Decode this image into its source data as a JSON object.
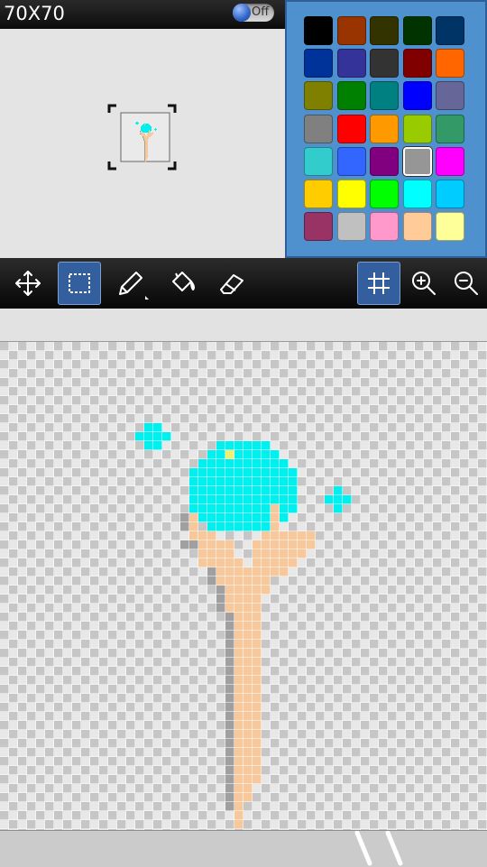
{
  "header": {
    "canvas_size": "70X70",
    "toggle_label": "Off",
    "toggle_state": "off"
  },
  "palette": {
    "selected_index": 23,
    "colors": [
      "#000000",
      "#993300",
      "#333300",
      "#003300",
      "#003366",
      "#003399",
      "#333399",
      "#333333",
      "#800000",
      "#ff6600",
      "#808000",
      "#008000",
      "#008080",
      "#0000ff",
      "#666699",
      "#808080",
      "#ff0000",
      "#ff9900",
      "#99cc00",
      "#339966",
      "#33cccc",
      "#3366ff",
      "#800080",
      "#969696",
      "#ff00ff",
      "#ffcc00",
      "#ffff00",
      "#00ff00",
      "#00ffff",
      "#00ccff",
      "#993366",
      "#c0c0c0",
      "#ff99cc",
      "#ffcc99",
      "#ffff99"
    ]
  },
  "toolbar": {
    "tools": [
      {
        "name": "move-icon",
        "active": false
      },
      {
        "name": "select-icon",
        "active": true
      },
      {
        "name": "pencil-icon",
        "active": false
      },
      {
        "name": "bucket-icon",
        "active": false
      },
      {
        "name": "eraser-icon",
        "active": false
      }
    ],
    "view": [
      {
        "name": "grid-icon",
        "active": true
      },
      {
        "name": "zoom-in-icon",
        "active": false
      },
      {
        "name": "zoom-out-icon",
        "active": false
      }
    ]
  },
  "drawing": {
    "columns": 54,
    "rows": 54,
    "colors": {
      "c": "#00f0f0",
      "s": "#f7c89b",
      "g": "#a0a0a0",
      "y": "#f0f070"
    },
    "pixels": [
      {
        "c": "c",
        "x": [
          16,
          17
        ],
        "y": [
          9,
          9
        ]
      },
      {
        "c": "c",
        "x": [
          15,
          18
        ],
        "y": [
          10,
          10
        ]
      },
      {
        "c": "c",
        "x": [
          16,
          17
        ],
        "y": [
          11,
          11
        ]
      },
      {
        "c": "c",
        "x": [
          24,
          29
        ],
        "y": [
          11,
          11
        ]
      },
      {
        "c": "c",
        "x": [
          23,
          30
        ],
        "y": [
          12,
          12
        ]
      },
      {
        "c": "c",
        "x": [
          22,
          31
        ],
        "y": [
          13,
          13
        ]
      },
      {
        "c": "c",
        "x": [
          21,
          32
        ],
        "y": [
          14,
          17
        ]
      },
      {
        "c": "c",
        "x": [
          37,
          37
        ],
        "y": [
          16,
          16
        ]
      },
      {
        "c": "c",
        "x": [
          36,
          38
        ],
        "y": [
          17,
          17
        ]
      },
      {
        "c": "c",
        "x": [
          37,
          37
        ],
        "y": [
          18,
          18
        ]
      },
      {
        "c": "c",
        "x": [
          21,
          32
        ],
        "y": [
          18,
          18
        ]
      },
      {
        "c": "c",
        "x": [
          22,
          31
        ],
        "y": [
          19,
          19
        ]
      },
      {
        "c": "c",
        "x": [
          23,
          29
        ],
        "y": [
          20,
          20
        ]
      },
      {
        "c": "y",
        "x": [
          25,
          25
        ],
        "y": [
          12,
          12
        ]
      },
      {
        "c": "s",
        "x": [
          30,
          30
        ],
        "y": [
          18,
          20
        ]
      },
      {
        "c": "g",
        "x": [
          20,
          20
        ],
        "y": [
          19,
          20
        ]
      },
      {
        "c": "s",
        "x": [
          21,
          21
        ],
        "y": [
          19,
          20
        ]
      },
      {
        "c": "s",
        "x": [
          21,
          23
        ],
        "y": [
          21,
          21
        ]
      },
      {
        "c": "s",
        "x": [
          29,
          34
        ],
        "y": [
          21,
          21
        ]
      },
      {
        "c": "g",
        "x": [
          20,
          21
        ],
        "y": [
          22,
          22
        ]
      },
      {
        "c": "s",
        "x": [
          22,
          25
        ],
        "y": [
          22,
          22
        ]
      },
      {
        "c": "s",
        "x": [
          28,
          34
        ],
        "y": [
          22,
          22
        ]
      },
      {
        "c": "s",
        "x": [
          22,
          25
        ],
        "y": [
          23,
          23
        ]
      },
      {
        "c": "s",
        "x": [
          28,
          33
        ],
        "y": [
          23,
          23
        ]
      },
      {
        "c": "s",
        "x": [
          22,
          26
        ],
        "y": [
          24,
          24
        ]
      },
      {
        "c": "s",
        "x": [
          28,
          32
        ],
        "y": [
          24,
          24
        ]
      },
      {
        "c": "g",
        "x": [
          23,
          23
        ],
        "y": [
          25,
          26
        ]
      },
      {
        "c": "s",
        "x": [
          24,
          31
        ],
        "y": [
          25,
          25
        ]
      },
      {
        "c": "s",
        "x": [
          24,
          29
        ],
        "y": [
          26,
          26
        ]
      },
      {
        "c": "g",
        "x": [
          24,
          24
        ],
        "y": [
          27,
          29
        ]
      },
      {
        "c": "s",
        "x": [
          25,
          29
        ],
        "y": [
          27,
          27
        ]
      },
      {
        "c": "s",
        "x": [
          25,
          28
        ],
        "y": [
          28,
          29
        ]
      },
      {
        "c": "g",
        "x": [
          25,
          25
        ],
        "y": [
          30,
          49
        ]
      },
      {
        "c": "s",
        "x": [
          26,
          28
        ],
        "y": [
          30,
          48
        ]
      },
      {
        "c": "s",
        "x": [
          26,
          27
        ],
        "y": [
          49,
          50
        ]
      },
      {
        "c": "g",
        "x": [
          25,
          25
        ],
        "y": [
          50,
          51
        ]
      },
      {
        "c": "s",
        "x": [
          26,
          26
        ],
        "y": [
          51,
          53
        ]
      }
    ]
  }
}
